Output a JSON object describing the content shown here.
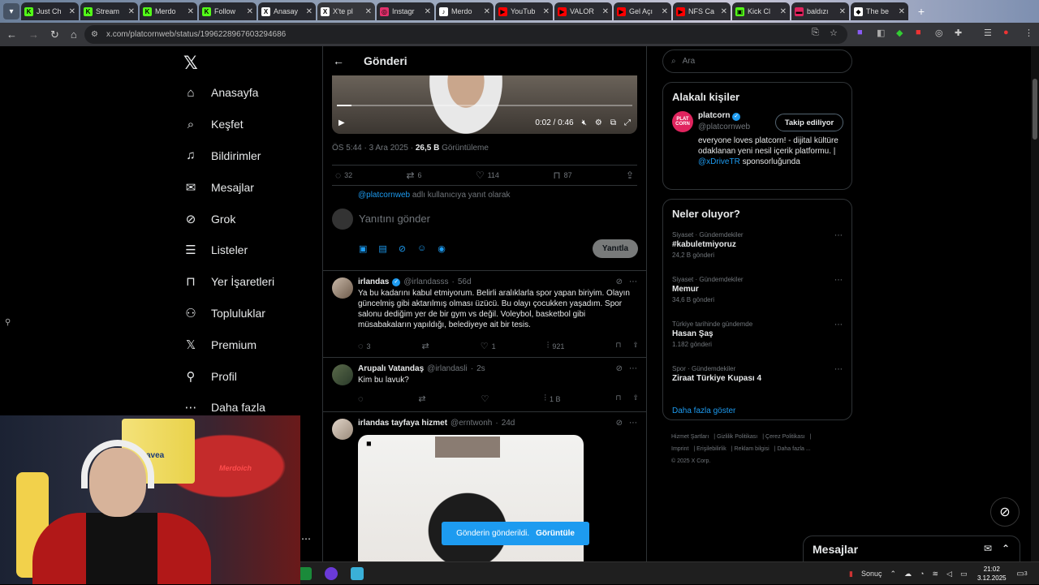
{
  "browser": {
    "tabs": [
      {
        "label": "Just Ch",
        "favicon": "K",
        "color": "#53fc18"
      },
      {
        "label": "Stream",
        "favicon": "K",
        "color": "#53fc18"
      },
      {
        "label": "Merdo",
        "favicon": "K",
        "color": "#53fc18"
      },
      {
        "label": "Follow",
        "favicon": "K",
        "color": "#53fc18"
      },
      {
        "label": "Anasay",
        "favicon": "X",
        "color": "#ffffff"
      },
      {
        "label": "X'te pl",
        "favicon": "X",
        "color": "#ffffff"
      },
      {
        "label": "Instagr",
        "favicon": "◎",
        "color": "#e1306c"
      },
      {
        "label": "Merdo",
        "favicon": "♪",
        "color": "#ffffff"
      },
      {
        "label": "YouTub",
        "favicon": "▶",
        "color": "#ff0000"
      },
      {
        "label": "VALOR",
        "favicon": "▶",
        "color": "#ff0000"
      },
      {
        "label": "Gel Açı",
        "favicon": "▶",
        "color": "#ff0000"
      },
      {
        "label": "NFS Ca",
        "favicon": "▶",
        "color": "#ff0000"
      },
      {
        "label": "Kick Cl",
        "favicon": "▣",
        "color": "#53fc18"
      },
      {
        "label": "baldızı",
        "favicon": "▬",
        "color": "#e0245e"
      },
      {
        "label": "The be",
        "favicon": "◆",
        "color": "#ffffff"
      }
    ],
    "active_tab_index": 5,
    "url": "x.com/platcornweb/status/1996228967603294686"
  },
  "nav": {
    "items": [
      {
        "label": "Anasayfa",
        "icon": "⌂"
      },
      {
        "label": "Keşfet",
        "icon": "⌕"
      },
      {
        "label": "Bildirimler",
        "icon": "♫"
      },
      {
        "label": "Mesajlar",
        "icon": "✉"
      },
      {
        "label": "Grok",
        "icon": "⊘"
      },
      {
        "label": "Listeler",
        "icon": "☰"
      },
      {
        "label": "Yer İşaretleri",
        "icon": "⊓"
      },
      {
        "label": "Topluluklar",
        "icon": "⚇"
      },
      {
        "label": "Premium",
        "icon": "𝕏"
      },
      {
        "label": "Profil",
        "icon": "⚲"
      },
      {
        "label": "Daha fazla",
        "icon": "⋯"
      }
    ]
  },
  "post": {
    "header_title": "Gönderi",
    "video_time": "0:02 / 0:46",
    "video_progress": 0.05,
    "timestamp": "ÖS 5:44 · 3 Ara 2025 · ",
    "views": "26,5 B",
    "views_label": "Görüntüleme",
    "replies": "32",
    "reposts": "6",
    "likes": "114",
    "bookmarks": "87",
    "reply_to_handle": "@platcornweb",
    "reply_to_text": "adlı kullanıcıya yanıt olarak",
    "compose_placeholder": "Yanıtını gönder",
    "reply_button": "Yanıtla"
  },
  "replies": [
    {
      "name": "irlandas",
      "handle": "@irlandasss",
      "time": "56d",
      "verified": true,
      "text": "Ya bu kadarını kabul etmiyorum. Belirli aralıklarla spor yapan biriyim. Olayın güncelmiş gibi aktarılmış olması üzücü. Bu olayı çocukken yaşadım. Spor salonu dediğim yer de bir gym vs değil. Voleybol, basketbol gibi müsabakaların yapıldığı, belediyeye ait bir tesis.",
      "replies": "3",
      "reposts": "",
      "likes": "1",
      "views": "921"
    },
    {
      "name": "Arupalı Vatandaş",
      "handle": "@irlandasli",
      "time": "2s",
      "verified": false,
      "text": "Kim bu lavuk?",
      "replies": "",
      "reposts": "",
      "likes": "",
      "views": "1 B"
    },
    {
      "name": "irlandas tayfaya hizmet",
      "handle": "@erntwonh",
      "time": "24d",
      "verified": false,
      "text": ""
    }
  ],
  "toast": {
    "text": "Gönderin gönderildi.",
    "action": "Görüntüle"
  },
  "sidebar": {
    "search_placeholder": "Ara",
    "related_title": "Alakalı kişiler",
    "person": {
      "name": "platcorn",
      "handle": "@platcornweb",
      "follow_label": "Takip ediliyor",
      "bio": "everyone loves platcorn! - dijital kültüre odaklanan yeni nesil içerik platformu. | ",
      "bio_link": "@xDriveTR",
      "bio_end": " sponsorluğunda",
      "avatar_text": "PLAT CORN"
    },
    "trends_title": "Neler oluyor?",
    "trends": [
      {
        "category": "Siyaset · Gündemdekiler",
        "title": "#kabuletmiyoruz",
        "count": "24,2 B gönderi"
      },
      {
        "category": "Siyaset · Gündemdekiler",
        "title": "Memur",
        "count": "34,6 B gönderi"
      },
      {
        "category": "Türkiye tarihinde gündemde",
        "title": "Hasan Şaş",
        "count": "1.182 gönderi"
      },
      {
        "category": "Spor · Gündemdekiler",
        "title": "Ziraat Türkiye Kupası 4",
        "count": ""
      }
    ],
    "show_more": "Daha fazla göster",
    "footer": [
      "Hizmet Şartları",
      "Gizlilik Politikası",
      "Çerez Politikası",
      "Imprint",
      "Erişilebilirlik",
      "Reklam bilgisi",
      "Daha fazla ...",
      "© 2025 X Corp."
    ]
  },
  "dm": {
    "title": "Mesajlar"
  },
  "webcam": {
    "sign": "Merdoich",
    "jersey": "avea"
  },
  "taskbar": {
    "search_label": "Sonuç",
    "time": "21:02",
    "date": "3.12.2025",
    "notifications": "3"
  }
}
